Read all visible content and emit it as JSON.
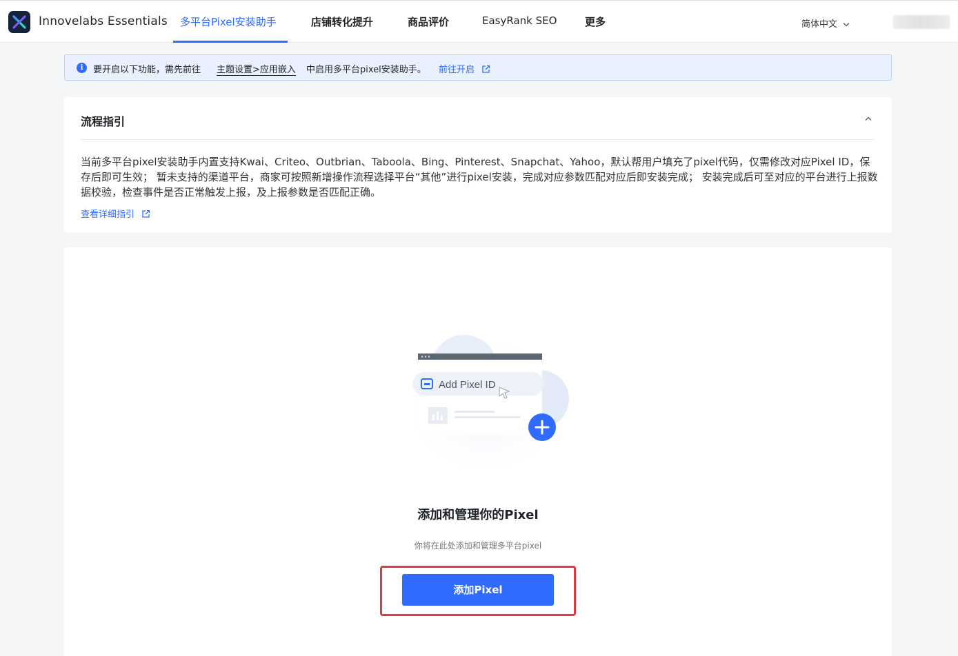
{
  "app": {
    "name": "Innovelabs Essentials",
    "logo_icon": "x-logo-icon"
  },
  "nav": {
    "tabs": [
      {
        "label": "多平台Pixel安装助手",
        "active": true
      },
      {
        "label": "店铺转化提升",
        "active": false
      },
      {
        "label": "商品评价",
        "active": false
      },
      {
        "label": "EasyRank SEO",
        "active": false
      },
      {
        "label": "更多",
        "active": false
      }
    ],
    "language": "简体中文"
  },
  "banner": {
    "text_before": "要开启以下功能，需先前往",
    "link_path": "主题设置>应用嵌入",
    "text_after": "中启用多平台pixel安装助手。",
    "action": "前往开启",
    "icon": "info-icon"
  },
  "guide": {
    "title": "流程指引",
    "description": "当前多平台pixel安装助手内置支持Kwai、Criteo、Outbrian、Taboola、Bing、Pinterest、Snapchat、Yahoo，默认帮用户填充了pixel代码，仅需修改对应Pixel ID，保存后即可生效； 暂未支持的渠道平台，商家可按照新增操作流程选择平台“其他”进行pixel安装，完成对应参数匹配对应后即安装完成； 安装完成后可至对应的平台进行上报数据校验，检查事件是否正常触发上报，及上报参数是否匹配正确。",
    "link": "查看详细指引"
  },
  "empty_state": {
    "illustration_label": "Add Pixel ID",
    "heading": "添加和管理你的Pixel",
    "subtext": "你将在此处添加和管理多平台pixel",
    "button": "添加Pixel"
  },
  "colors": {
    "accent": "#2f6bff",
    "highlight_border": "#e0383e",
    "banner_bg": "#e9f1fe"
  }
}
